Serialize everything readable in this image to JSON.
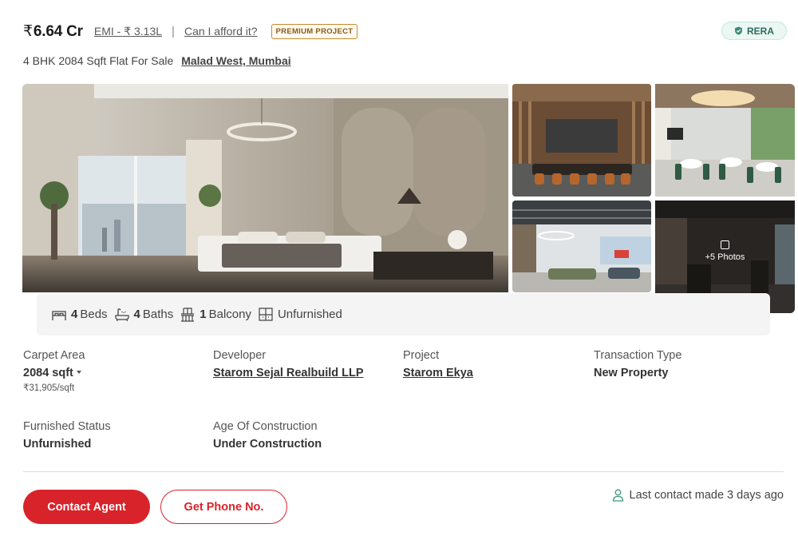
{
  "listing": {
    "price_symbol": "₹",
    "price": "6.64 Cr",
    "emi": "EMI - ₹ 3.13L",
    "separator": "|",
    "afford_link": "Can I afford it?",
    "premium_badge": "PREMIUM PROJECT",
    "rera_badge": "RERA",
    "title": "4 BHK 2084 Sqft Flat For Sale",
    "location": "Malad West, Mumbai"
  },
  "gallery": {
    "more_photos": "+5 Photos",
    "icons": [
      "image-icon"
    ]
  },
  "amenities": [
    {
      "icon": "bed-icon",
      "count": "4",
      "label": "Beds"
    },
    {
      "icon": "bath-icon",
      "count": "4",
      "label": "Baths"
    },
    {
      "icon": "balcony-icon",
      "count": "1",
      "label": "Balcony"
    },
    {
      "icon": "furnishing-icon",
      "count": "",
      "label": "Unfurnished"
    }
  ],
  "details": {
    "carpet_area": {
      "label": "Carpet Area",
      "value": "2084 sqft",
      "sub": "₹31,905/sqft"
    },
    "developer": {
      "label": "Developer",
      "value": "Starom Sejal Realbuild LLP"
    },
    "project": {
      "label": "Project",
      "value": "Starom Ekya"
    },
    "transaction_type": {
      "label": "Transaction Type",
      "value": "New Property"
    },
    "furnished_status": {
      "label": "Furnished Status",
      "value": "Unfurnished"
    },
    "age_of_construction": {
      "label": "Age Of Construction",
      "value": "Under Construction"
    }
  },
  "actions": {
    "contact_agent": "Contact Agent",
    "get_phone": "Get Phone No.",
    "last_contact": "Last contact made 3 days ago"
  },
  "colors": {
    "primary_red": "#d8232a",
    "rera_green": "#2f6b5e",
    "premium_gold": "#c98a2c"
  }
}
